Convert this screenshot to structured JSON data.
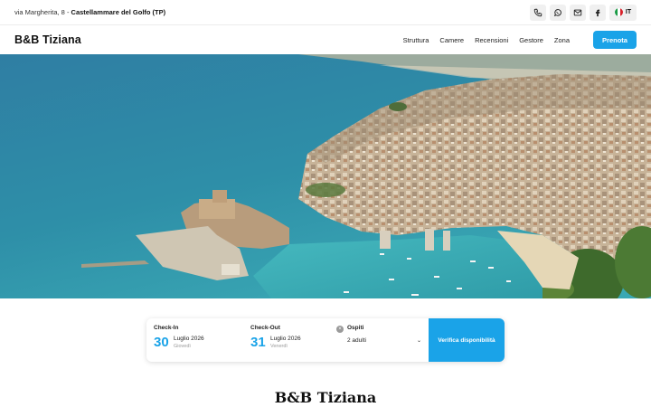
{
  "topbar": {
    "address_prefix": "via Margherita, 8 - ",
    "address_city": "Castellammare del Golfo (TP)",
    "icons": [
      "phone-icon",
      "whatsapp-icon",
      "mail-icon",
      "facebook-icon"
    ],
    "language": "IT"
  },
  "nav": {
    "brand": "B&B Tiziana",
    "items": [
      "Struttura",
      "Camere",
      "Recensioni",
      "Gestore",
      "Zona"
    ],
    "cta": "Prenota"
  },
  "colors": {
    "accent": "#1aa3e8"
  },
  "booking": {
    "checkin": {
      "label": "Check-In",
      "day": "30",
      "month": "Luglio 2026",
      "weekday": "Giovedì"
    },
    "checkout": {
      "label": "Check-Out",
      "day": "31",
      "month": "Luglio 2026",
      "weekday": "Venerdì"
    },
    "guests": {
      "label": "Ospiti",
      "value": "2 adulti"
    },
    "submit": "Verifica disponibilità"
  },
  "section": {
    "title": "B&B Tiziana"
  }
}
